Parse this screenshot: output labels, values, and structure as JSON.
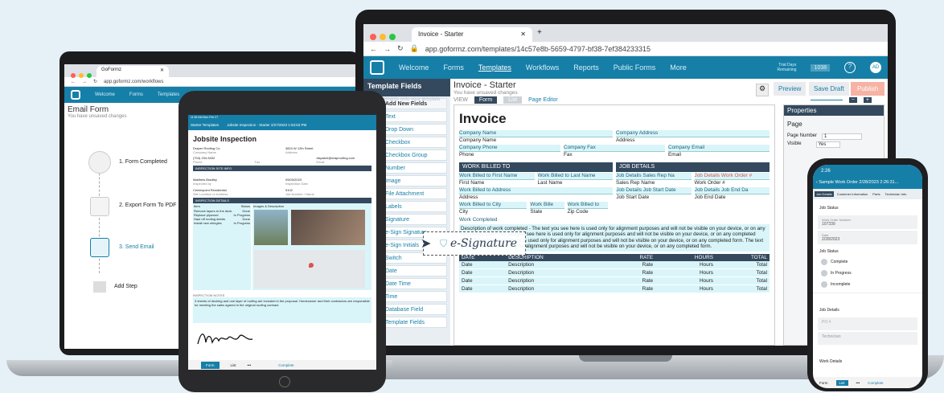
{
  "browser": {
    "tab_title": "Invoice - Starter",
    "url": "app.goformz.com/templates/14c57e8b-5659-4797-bf38-7ef384233315"
  },
  "nav": {
    "items": [
      "Welcome",
      "Forms",
      "Templates",
      "Workflows",
      "Reports",
      "Public Forms",
      "More"
    ],
    "trial_label": "Trial Days Remaining",
    "trial_days": "1038",
    "avatar": "AD"
  },
  "template": {
    "title": "Invoice - Starter",
    "subtitle": "You have unsaved changes",
    "preview": "Preview",
    "save_draft": "Save Draft",
    "publish": "Publish"
  },
  "fields_panel": {
    "title": "Template Fields",
    "subtitle": "Drag elements onto your template",
    "add_new": "Add New Fields",
    "items": [
      "Text",
      "Drop Down",
      "Checkbox",
      "Checkbox Group",
      "Number",
      "Image",
      "File Attachment",
      "Labels",
      "Signature",
      "e-Sign Signature",
      "e-Sign Initials",
      "Switch",
      "Date",
      "Date Time",
      "Time",
      "Database Field",
      "Template Fields"
    ],
    "drag_label": "e-Signature"
  },
  "editor": {
    "view_label": "VIEW",
    "form_tab": "Form",
    "list_tab": "List",
    "page_editor": "Page Editor"
  },
  "invoice": {
    "title": "Invoice",
    "company_name_label": "Company Name",
    "company_name": "Company Name",
    "company_address_label": "Company Address",
    "company_address": "Address",
    "company_phone_label": "Company Phone",
    "company_phone": "Phone",
    "company_fax_label": "Company Fax",
    "company_fax": "Fax",
    "company_email_label": "Company Email",
    "company_email": "Email",
    "billed_header": "WORK BILLED TO",
    "job_header": "JOB DETAILS",
    "bf_first_label": "Work Billed to First Name",
    "bf_first": "First Name",
    "bf_last_label": "Work Billed to Last Name",
    "bf_last": "Last Name",
    "bf_addr_label": "Work Billed to Address",
    "bf_addr": "Address",
    "bf_city_label": "Work Billed to City",
    "bf_city": "City",
    "bf_state_label": "Work Bille",
    "bf_state": "State",
    "bf_zip_label": "Work Billed to",
    "bf_zip": "Zip Code",
    "jd_rep_label": "Job Details Sales Rep Na",
    "jd_rep": "Sales Rep Name",
    "jd_order_label": "Job Details Work Order #",
    "jd_order": "Work Order #",
    "jd_start_label": "Job Details Job Start Date",
    "jd_start": "Job Start Date",
    "jd_end_label": "Job Details Job End Da",
    "jd_end": "Job End Date",
    "completed_label": "Work Completed",
    "description": "Description of work completed - The text you see here is used only for alignment purposes and will not be visible on your device, or on any completed form. The text you see here is used only for alignment purposes and will not be visible on your device, or on any completed form. The text you see here is used only for alignment purposes and will not be visible on your device, or on any completed form. The text you see here is used only for alignment purposes and will not be visible on your device, or on any completed form.",
    "cols": [
      "DATE",
      "DESCRIPTION",
      "RATE",
      "HOURS",
      "TOTAL"
    ],
    "rows": [
      [
        "Date",
        "Description",
        "Rate",
        "Hours",
        "Total"
      ],
      [
        "Date",
        "Description",
        "Rate",
        "Hours",
        "Total"
      ],
      [
        "Date",
        "Description",
        "Rate",
        "Hours",
        "Total"
      ],
      [
        "Date",
        "Description",
        "Rate",
        "Hours",
        "Total"
      ]
    ]
  },
  "properties": {
    "title": "Properties",
    "section": "Page",
    "page_number_label": "Page Number",
    "page_number": "1",
    "visible_label": "Visible",
    "visible_value": "Yes"
  },
  "small_laptop": {
    "tab": "GoFormz",
    "url": "app.goformz.com/workflows",
    "nav": [
      "Welcome",
      "Forms",
      "Templates"
    ],
    "title": "Email Form",
    "subtitle": "You have unsaved changes",
    "steps": [
      "1. Form Completed",
      "2. Export Form To PDF",
      "3. Send Email",
      "Add Step"
    ]
  },
  "tablet": {
    "status": "11:59 AM  Mon Feb 27",
    "back": "Starter Templates",
    "header": "Jobsite Inspection - Starter 2/27/2023 1:53:53 PM",
    "title": "Jobsite Inspection",
    "company": "Draper Roofing Co.",
    "company_label": "Company Name",
    "address": "3824 W 12th Street",
    "address_label": "Address",
    "phone": "(704) 234-5432",
    "phone_label": "Phone",
    "fax_label": "Fax",
    "email": "dispatch@draproofing.com",
    "email_label": "Email",
    "sec_info": "INSPECTION SITE INFO",
    "inspector": "Matthew Bradley",
    "inspector_label": "Inspected by",
    "date": "09/03/2023",
    "date_label": "Inspection Date",
    "site": "Centerpoint Residential",
    "site_label": "Site Location or Address",
    "job": "5102",
    "job_label": "Job Number / Name",
    "sec_details": "INSPECTION DETAILS",
    "col_item": "Item",
    "col_status": "Status",
    "col_images": "Images & Description",
    "items": [
      [
        "Remove layers to the deck",
        "Done"
      ],
      [
        "Replace plywood",
        "In Progress"
      ],
      [
        "Haul off roofing debris",
        "Done"
      ],
      [
        "Install new shingles",
        "In Progress"
      ]
    ],
    "notes_label": "INSPECTION NOTES",
    "notes": "3 sheets of decking and one layer of roofing are included in the proposal. Homeowner and their contractors are responsible for meeting the sales agreed in the original roofing contract.",
    "footer": [
      "Form",
      "List",
      "Complete"
    ]
  },
  "phone": {
    "time": "2:26",
    "title": "Sample Work Order 2/28/2023 2:26:31...",
    "tabs": [
      "Job Details",
      "Customer Information",
      "Parts",
      "Technician Info"
    ],
    "status_label": "Job Status",
    "order_label": "Work Order Number",
    "order": "107339",
    "date_label": "Date",
    "date": "2/28/2023",
    "status_field": "Job Status",
    "options": [
      "Complete",
      "In Progress",
      "Incomplete"
    ],
    "details_label": "Job Details",
    "po_placeholder": "PO #",
    "tech_placeholder": "Technician",
    "work_label": "Work Details",
    "footer": [
      "Form",
      "List",
      "Complete"
    ]
  }
}
